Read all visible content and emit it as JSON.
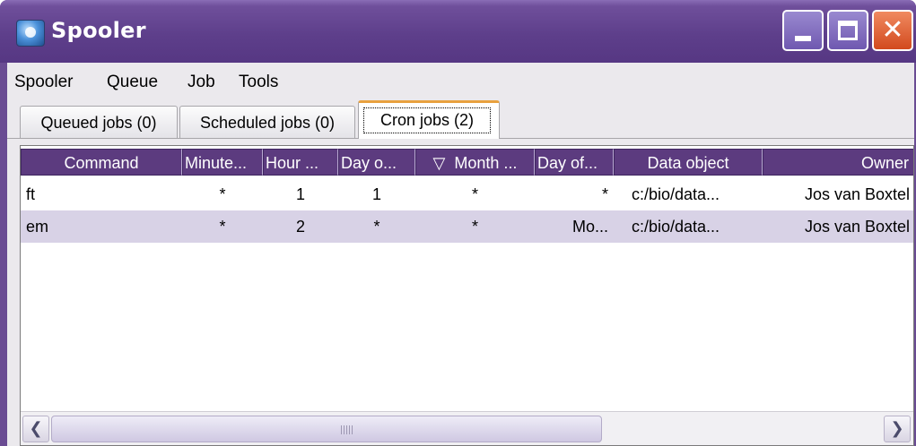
{
  "window": {
    "title": "Spooler"
  },
  "menu": [
    "Spooler",
    "Queue",
    "Job",
    "Tools"
  ],
  "tabs": [
    {
      "label": "Queued jobs (0)",
      "selected": false
    },
    {
      "label": "Scheduled jobs (0)",
      "selected": false
    },
    {
      "label": "Cron jobs (2)",
      "selected": true
    }
  ],
  "table": {
    "columns": [
      "Command",
      "Minute...",
      "Hour ...",
      "Day o...",
      "Month ...",
      "Day of...",
      "Data object",
      "Owner"
    ],
    "sort_indicator": "▽",
    "rows": [
      [
        "ft",
        "*",
        "1",
        "1",
        "*",
        "*",
        "c:/bio/data...",
        "Jos van Boxtel"
      ],
      [
        "em",
        "*",
        "2",
        "*",
        "*",
        "Mo...",
        "c:/bio/data...",
        "Jos van Boxtel"
      ]
    ],
    "selected_row": 1
  },
  "icons": {
    "app": "java-cup-icon",
    "minimize": "minimize-icon",
    "maximize": "maximize-icon",
    "close": "close-icon",
    "scroll_left": "chevron-left-icon",
    "scroll_right": "chevron-right-icon",
    "sort": "sort-desc-icon"
  },
  "colors": {
    "titlebar": "#5e3f8b",
    "header_bg": "#5c3b7f",
    "selected_row": "#d8d2e6",
    "active_tab_accent": "#e8a13f"
  }
}
